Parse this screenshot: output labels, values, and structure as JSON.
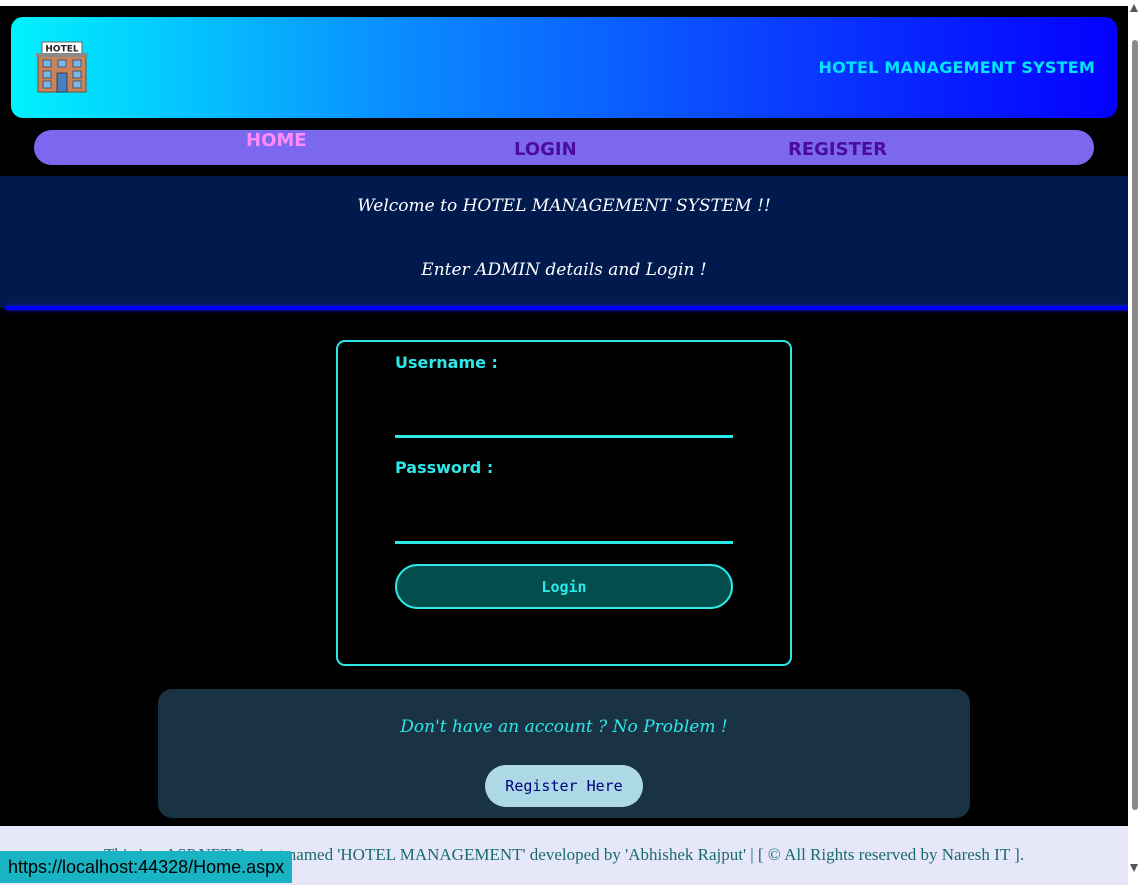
{
  "header": {
    "logo_text": "HOTEL",
    "brand_title": "HOTEL MANAGEMENT SYSTEM"
  },
  "nav": {
    "items": [
      {
        "label": "HOME",
        "active": true
      },
      {
        "label": "LOGIN",
        "active": false
      },
      {
        "label": "REGISTER",
        "active": false
      }
    ]
  },
  "welcome": {
    "line1": "Welcome to HOTEL MANAGEMENT SYSTEM !!",
    "line2": "Enter ADMIN details and Login !"
  },
  "login_form": {
    "username_label": "Username :",
    "username_value": "",
    "password_label": "Password :",
    "password_value": "",
    "login_button": "Login"
  },
  "register": {
    "prompt": "Don't have an account ? No Problem !",
    "button_label": "Register Here"
  },
  "footer": {
    "text": "This is a ASP.NET Project named 'HOTEL MANAGEMENT' developed by 'Abhishek Rajput' | [ © All Rights reserved by Naresh IT ]."
  },
  "status_bar": {
    "url": "https://localhost:44328/Home.aspx"
  },
  "colors": {
    "accent": "#2ee8e8",
    "nav_bg": "#7b68ee",
    "welcome_bg": "#001a4d",
    "register_panel_bg": "#1a3344"
  },
  "icons": {
    "logo": "hotel-building-icon"
  }
}
